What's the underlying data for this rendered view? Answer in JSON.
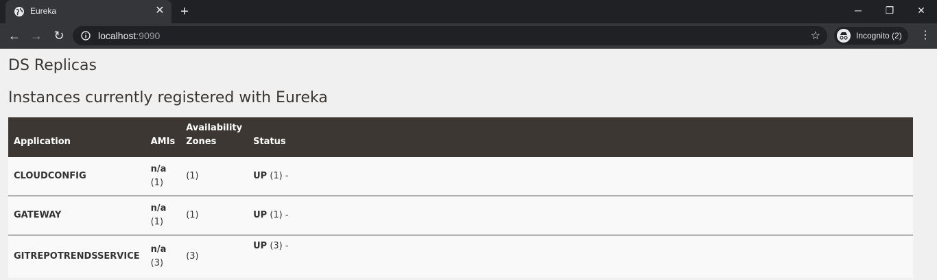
{
  "browser": {
    "tab_title": "Eureka",
    "url_host": "localhost",
    "url_port": ":9090",
    "incognito_label": "Incognito (2)",
    "icons": [
      "globe-icon",
      "close-icon",
      "plus-icon",
      "minimize-icon",
      "restore-icon",
      "window-close-icon",
      "back-icon",
      "forward-icon",
      "reload-icon",
      "info-icon",
      "star-icon",
      "incognito-icon",
      "menu-icon"
    ]
  },
  "page": {
    "heading": "DS Replicas",
    "subheading": "Instances currently registered with Eureka",
    "table": {
      "headers": {
        "application": "Application",
        "amis": "AMIs",
        "zones_line1": "Availability",
        "zones_line2": "Zones",
        "status": "Status"
      },
      "rows": [
        {
          "application": "CLOUDCONFIG",
          "amis": "n/a",
          "amis_count": "(1)",
          "zones": "(1)",
          "status": "UP",
          "status_count": " (1) -"
        },
        {
          "application": "GATEWAY",
          "amis": "n/a",
          "amis_count": "(1)",
          "zones": "(1)",
          "status": "UP",
          "status_count": " (1) -"
        },
        {
          "application": "GITREPOTRENDSSERVICE",
          "amis": "n/a",
          "amis_count": "(3)",
          "zones": "(3)",
          "status": "UP",
          "status_count": " (3) -"
        }
      ]
    }
  },
  "colors": {
    "table_header_bg": "#3c3732",
    "page_bg": "#f0f0f0",
    "browser_frame": "#202124"
  }
}
